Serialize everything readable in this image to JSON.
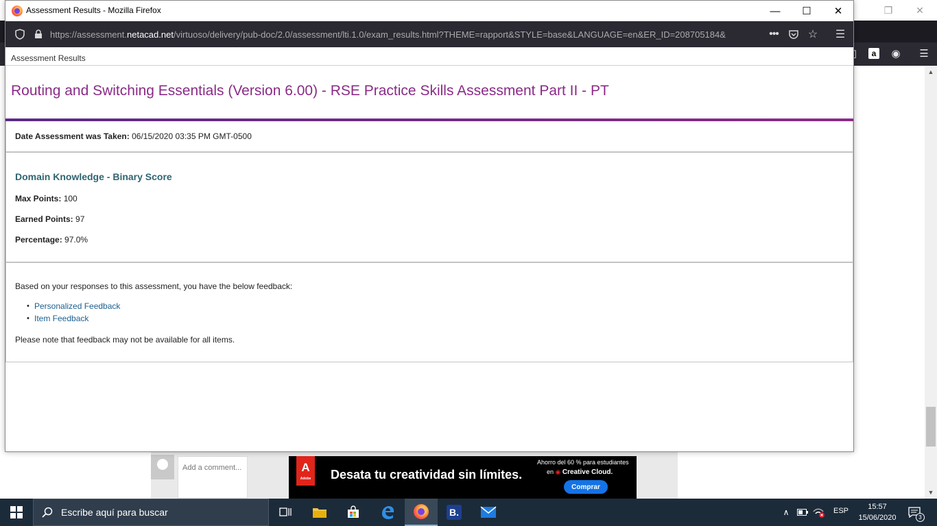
{
  "background_window": {
    "ad": {
      "logo_text": "A",
      "logo_sub": "Adobe",
      "headline": "Desata tu creatividad sin límites.",
      "discount": "Ahorro del 60 % para estudiantes",
      "cc_prefix": "en",
      "cc_name": "Creative Cloud.",
      "buy_button": "Comprar"
    },
    "comment_placeholder": "Add a comment..."
  },
  "popup": {
    "window_title": "Assessment Results - Mozilla Firefox",
    "url_prefix": "https://assessment.",
    "url_domain": "netacad.net",
    "url_path": "/virtuoso/delivery/pub-doc/2.0/assessment/lti.1.0/exam_results.html?THEME=rapport&STYLE=base&LANGUAGE=en&ER_ID=208705184&",
    "breadcrumb": "Assessment Results",
    "page_title": "Routing and Switching Essentials (Version 6.00) - RSE Practice Skills Assessment Part II - PT",
    "date_label": "Date Assessment was Taken:",
    "date_value": "06/15/2020 03:35 PM GMT-0500",
    "domain_heading": "Domain Knowledge - Binary Score",
    "max_points_label": "Max Points:",
    "max_points_value": "100",
    "earned_points_label": "Earned Points:",
    "earned_points_value": "97",
    "percentage_label": "Percentage:",
    "percentage_value": "97.0%",
    "feedback_intro": "Based on your responses to this assessment, you have the below feedback:",
    "feedback_links": [
      "Personalized Feedback",
      "Item Feedback"
    ],
    "feedback_note": "Please note that feedback may not be available for all items."
  },
  "taskbar": {
    "search_placeholder": "Escribe aquí para buscar",
    "language": "ESP",
    "time": "15:57",
    "date": "15/06/2020",
    "notification_count": "3"
  }
}
